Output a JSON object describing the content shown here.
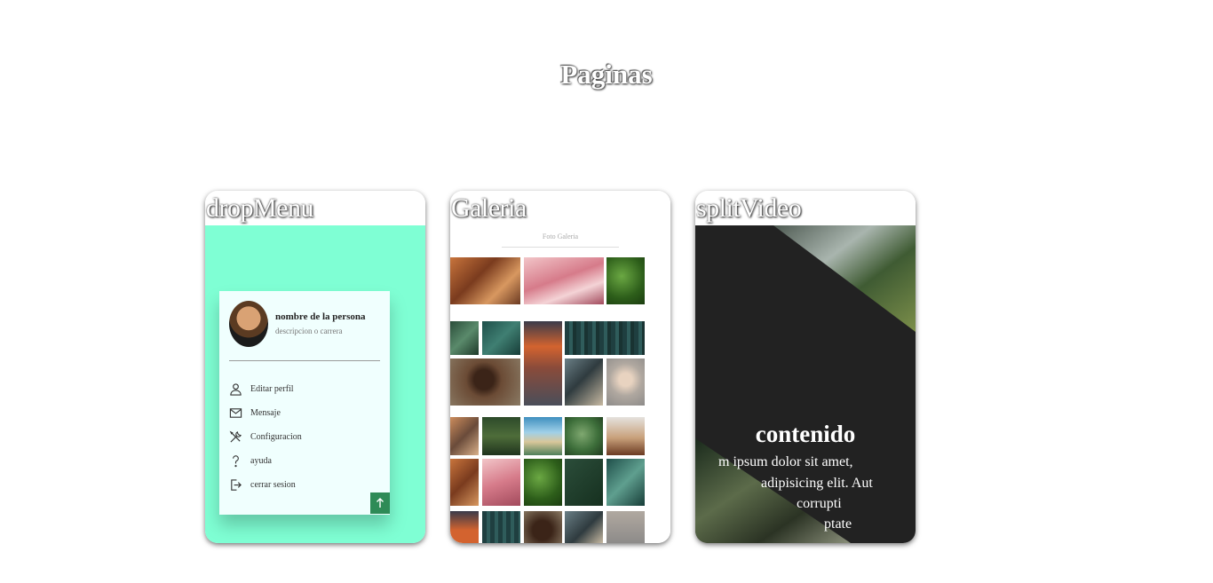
{
  "page": {
    "title": "Paginas"
  },
  "cards": [
    {
      "title": "dropMenu",
      "preview": {
        "name": "nombre de la persona",
        "description": "descripcion o carrera",
        "menu": [
          {
            "label": "Editar perfil",
            "icon": "user-icon"
          },
          {
            "label": "Mensaje",
            "icon": "mail-icon"
          },
          {
            "label": "Configuracion",
            "icon": "tools-icon"
          },
          {
            "label": "ayuda",
            "icon": "question-icon"
          },
          {
            "label": "cerrar sesion",
            "icon": "logout-icon"
          }
        ],
        "scroll_icon": "arrow-up-icon",
        "background": "#7fffd4",
        "accent": "#2e8b57"
      }
    },
    {
      "title": "Galeria",
      "preview": {
        "heading": "Foto Galeria",
        "background": "#ffffff"
      }
    },
    {
      "title": "splitVideo",
      "preview": {
        "heading": "contenido",
        "lines": [
          "m ipsum dolor sit amet,",
          "adipisicing elit. Aut",
          "corrupti",
          "ptate"
        ],
        "background": "#222222"
      }
    }
  ]
}
